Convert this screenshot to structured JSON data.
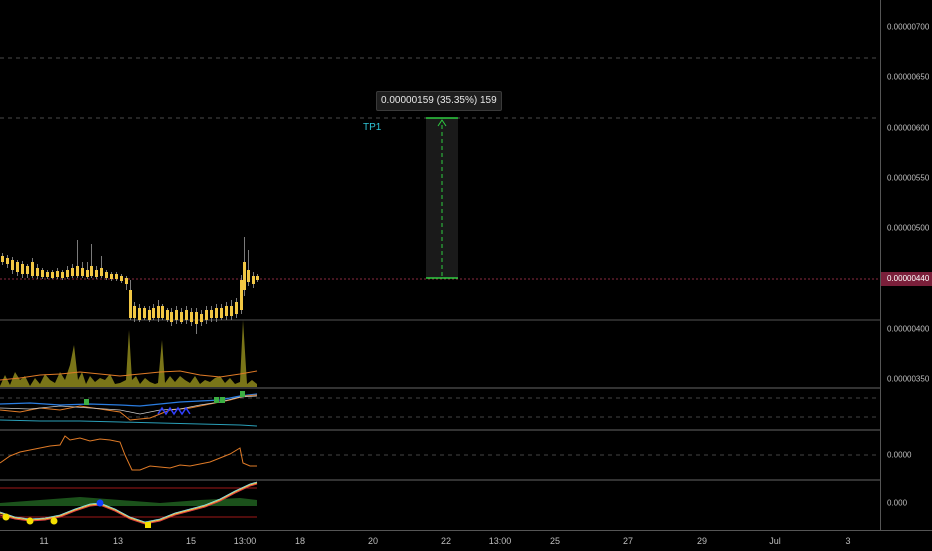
{
  "measure": {
    "label": "0.00000159 (35.35%) 159"
  },
  "annotation": {
    "tp_label": "TP1"
  },
  "price_axis": {
    "ticks": [
      "0.00000700",
      "0.00000650",
      "0.00000600",
      "0.00000550",
      "0.00000500",
      "0.00000400",
      "0.00000350"
    ],
    "current_price": "0.00000440"
  },
  "osc1_axis": {
    "tick": "0.0000"
  },
  "osc2_axis": {
    "tick": "0.000"
  },
  "time_axis": {
    "labels": [
      "11",
      "13",
      "15",
      "13:00",
      "18",
      "20",
      "22",
      "13:00",
      "25",
      "27",
      "29",
      "Jul",
      "3"
    ]
  },
  "colors": {
    "background": "#000000",
    "candle": "#f2c744",
    "wick": "#9a9a9a",
    "volume": "#8f8a1c",
    "measure_line": "#2ecc40",
    "current_price": "#7a1f3a",
    "tp_text": "#2ec4d6"
  }
}
